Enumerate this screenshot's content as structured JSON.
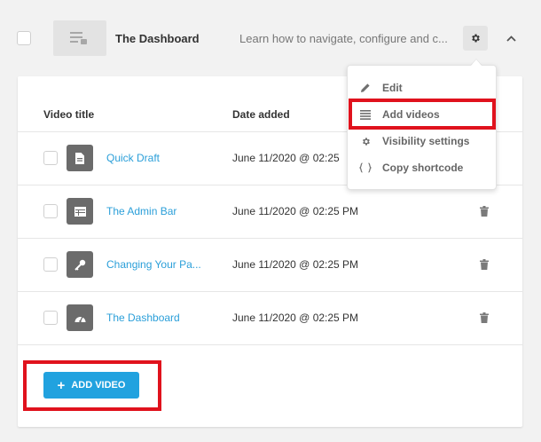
{
  "playlist": {
    "title": "The Dashboard",
    "description": "Learn how to navigate, configure and c..."
  },
  "table": {
    "headers": {
      "title": "Video title",
      "date": "Date added"
    },
    "rows": [
      {
        "title": "Quick Draft",
        "date": "June 11/2020 @ 02:25",
        "icon": "document-icon"
      },
      {
        "title": "The Admin Bar",
        "date": "June 11/2020 @ 02:25 PM",
        "icon": "table-icon"
      },
      {
        "title": "Changing Your Pa...",
        "date": "June 11/2020 @ 02:25 PM",
        "icon": "key-icon"
      },
      {
        "title": "The Dashboard",
        "date": "June 11/2020 @ 02:25 PM",
        "icon": "gauge-icon"
      }
    ]
  },
  "actions": {
    "add_video": "ADD VIDEO"
  },
  "menu": {
    "items": [
      {
        "label": "Edit",
        "icon": "pencil-icon"
      },
      {
        "label": "Add videos",
        "icon": "list-icon"
      },
      {
        "label": "Visibility settings",
        "icon": "gear-icon"
      },
      {
        "label": "Copy shortcode",
        "icon": "braces-icon"
      }
    ]
  },
  "colors": {
    "accent": "#21a2df",
    "link": "#2b9fd9",
    "highlight": "#e0121d",
    "icon_tile": "#6b6b6b"
  }
}
